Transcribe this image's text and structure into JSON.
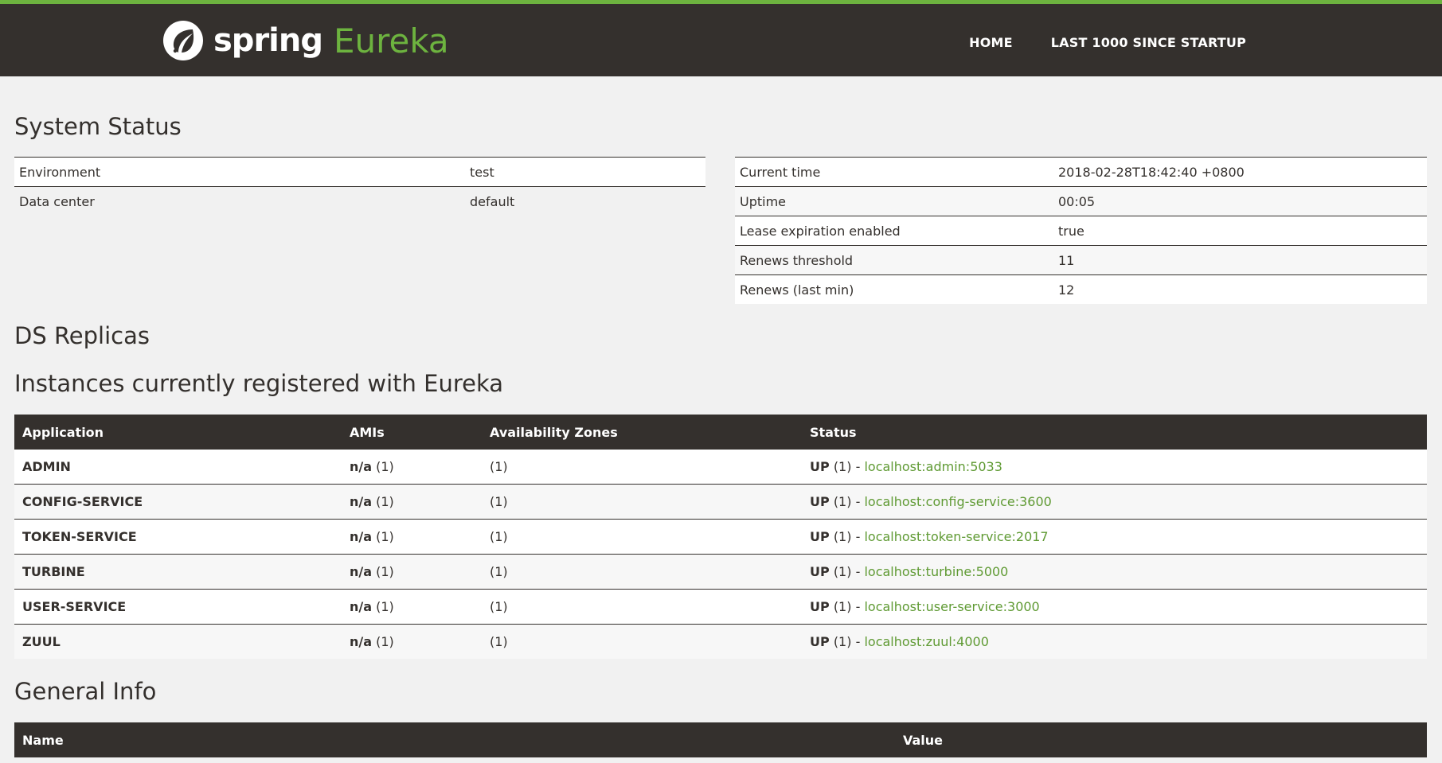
{
  "header": {
    "logo_spring": "spring",
    "logo_eureka": "Eureka",
    "nav": [
      "HOME",
      "LAST 1000 SINCE STARTUP"
    ]
  },
  "system_status": {
    "title": "System Status",
    "left": [
      {
        "label": "Environment",
        "value": "test"
      },
      {
        "label": "Data center",
        "value": "default"
      }
    ],
    "right": [
      {
        "label": "Current time",
        "value": "2018-02-28T18:42:40 +0800"
      },
      {
        "label": "Uptime",
        "value": "00:05"
      },
      {
        "label": "Lease expiration enabled",
        "value": "true"
      },
      {
        "label": "Renews threshold",
        "value": "11"
      },
      {
        "label": "Renews (last min)",
        "value": "12"
      }
    ]
  },
  "ds_replicas": {
    "title": "DS Replicas"
  },
  "instances": {
    "title": "Instances currently registered with Eureka",
    "columns": [
      "Application",
      "AMIs",
      "Availability Zones",
      "Status"
    ],
    "rows": [
      {
        "app": "ADMIN",
        "ami": "n/a",
        "ami_count": "(1)",
        "zones": "(1)",
        "status": "UP",
        "status_count": "(1)",
        "sep": "-",
        "link": "localhost:admin:5033"
      },
      {
        "app": "CONFIG-SERVICE",
        "ami": "n/a",
        "ami_count": "(1)",
        "zones": "(1)",
        "status": "UP",
        "status_count": "(1)",
        "sep": "-",
        "link": "localhost:config-service:3600"
      },
      {
        "app": "TOKEN-SERVICE",
        "ami": "n/a",
        "ami_count": "(1)",
        "zones": "(1)",
        "status": "UP",
        "status_count": "(1)",
        "sep": "-",
        "link": "localhost:token-service:2017"
      },
      {
        "app": "TURBINE",
        "ami": "n/a",
        "ami_count": "(1)",
        "zones": "(1)",
        "status": "UP",
        "status_count": "(1)",
        "sep": "-",
        "link": "localhost:turbine:5000"
      },
      {
        "app": "USER-SERVICE",
        "ami": "n/a",
        "ami_count": "(1)",
        "zones": "(1)",
        "status": "UP",
        "status_count": "(1)",
        "sep": "-",
        "link": "localhost:user-service:3000"
      },
      {
        "app": "ZUUL",
        "ami": "n/a",
        "ami_count": "(1)",
        "zones": "(1)",
        "status": "UP",
        "status_count": "(1)",
        "sep": "-",
        "link": "localhost:zuul:4000"
      }
    ]
  },
  "general_info": {
    "title": "General Info",
    "columns": [
      "Name",
      "Value"
    ]
  },
  "colors": {
    "brand_green": "#6db33f",
    "header_bg": "#34302d",
    "link_green": "#5f9a33",
    "page_bg": "#f1f1f1"
  },
  "icons": [
    "spring-leaf-icon"
  ]
}
